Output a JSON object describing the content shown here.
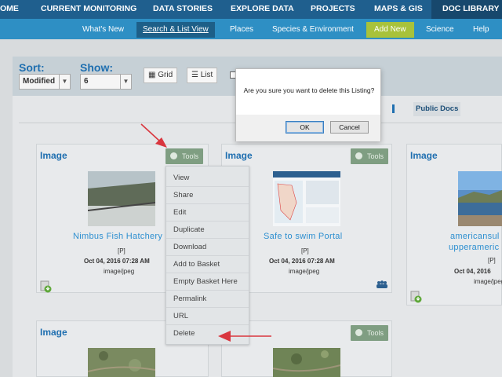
{
  "topnav": {
    "items": [
      "OME",
      "CURRENT MONITORING",
      "DATA STORIES",
      "EXPLORE DATA",
      "PROJECTS",
      "MAPS & GIS",
      "DOC LIBRARY"
    ]
  },
  "subnav": {
    "items": [
      "What's New",
      "Search & List View",
      "Places",
      "Species & Environment",
      "Add New",
      "Science",
      "Help"
    ]
  },
  "toolbar": {
    "sort_label": "Sort:",
    "sort_value": "Modified",
    "show_label": "Show:",
    "show_value": "6",
    "grid_label": "Grid",
    "list_label": "List",
    "public_docs": "Public Docs"
  },
  "cards": [
    {
      "type": "Image",
      "tools": "Tools",
      "title": "Nimbus Fish Hatchery",
      "flag": "[P]",
      "date": "Oct 04, 2016 07:28 AM",
      "mime": "image/jpeg"
    },
    {
      "type": "Image",
      "tools": "Tools",
      "title": "Safe to swim Portal",
      "flag": "[P]",
      "date": "Oct 04, 2016 07:28 AM",
      "mime": "image/jpeg"
    },
    {
      "type": "Image",
      "tools": "Tools",
      "title": "americansul",
      "title2": "upperameric",
      "flag": "[P]",
      "date": "Oct 04, 2016",
      "mime": "image/jpeg"
    },
    {
      "type": "Image",
      "tools": "Tools"
    },
    {
      "type": "Image",
      "tools": "Tools"
    }
  ],
  "menu": {
    "items": [
      "View",
      "Share",
      "Edit",
      "Duplicate",
      "Download",
      "Add to Basket",
      "Empty Basket Here",
      "Permalink",
      "URL",
      "Delete"
    ]
  },
  "dialog": {
    "message": "Are you sure you want to delete this Listing?",
    "ok": "OK",
    "cancel": "Cancel"
  },
  "colors": {
    "topnav": "#1f5f8e",
    "subnav": "#2e8fc4",
    "add_new": "#a8c23b",
    "tools": "#7f9e82",
    "link": "#2d8fd0",
    "annotation_arrow": "#d9363e"
  }
}
